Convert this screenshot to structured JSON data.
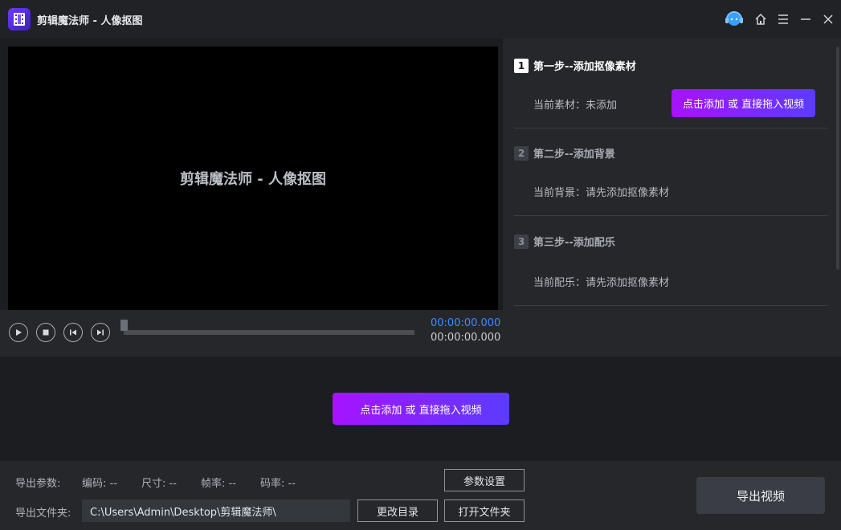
{
  "window": {
    "title": "剪辑魔法师 - 人像抠图",
    "controls": {
      "support_icon": "headset-icon",
      "home_icon": "home-icon",
      "menu_icon": "menu-icon",
      "minimize_icon": "minimize-icon",
      "close_icon": "close-icon"
    }
  },
  "preview": {
    "watermark": "剪辑魔法师 - 人像抠图",
    "current_time": "00:00:00.000",
    "total_time": "00:00:00.000",
    "progress": 0
  },
  "steps": [
    {
      "num": "1",
      "title": "第一步--添加抠像素材",
      "info": "当前素材：未添加",
      "button": "点击添加 或 直接拖入视频",
      "active": true
    },
    {
      "num": "2",
      "title": "第二步--添加背景",
      "info": "当前背景：请先添加抠像素材",
      "active": false
    },
    {
      "num": "3",
      "title": "第三步--添加配乐",
      "info": "当前配乐：请先添加抠像素材",
      "active": false
    }
  ],
  "center": {
    "add_button": "点击添加 或 直接拖入视频"
  },
  "export": {
    "params_label": "导出参数:",
    "codec": "编码: --",
    "size": "尺寸: --",
    "framerate": "帧率: --",
    "bitrate": "码率: --",
    "settings_button": "参数设置",
    "folder_label": "导出文件夹:",
    "folder_path": "C:\\Users\\Admin\\Desktop\\剪辑魔法师\\",
    "change_dir_button": "更改目录",
    "open_folder_button": "打开文件夹",
    "export_button": "导出视频"
  },
  "colors": {
    "accent_start": "#a613ff",
    "accent_end": "#5b3bff",
    "time_blue": "#3d8bff"
  }
}
